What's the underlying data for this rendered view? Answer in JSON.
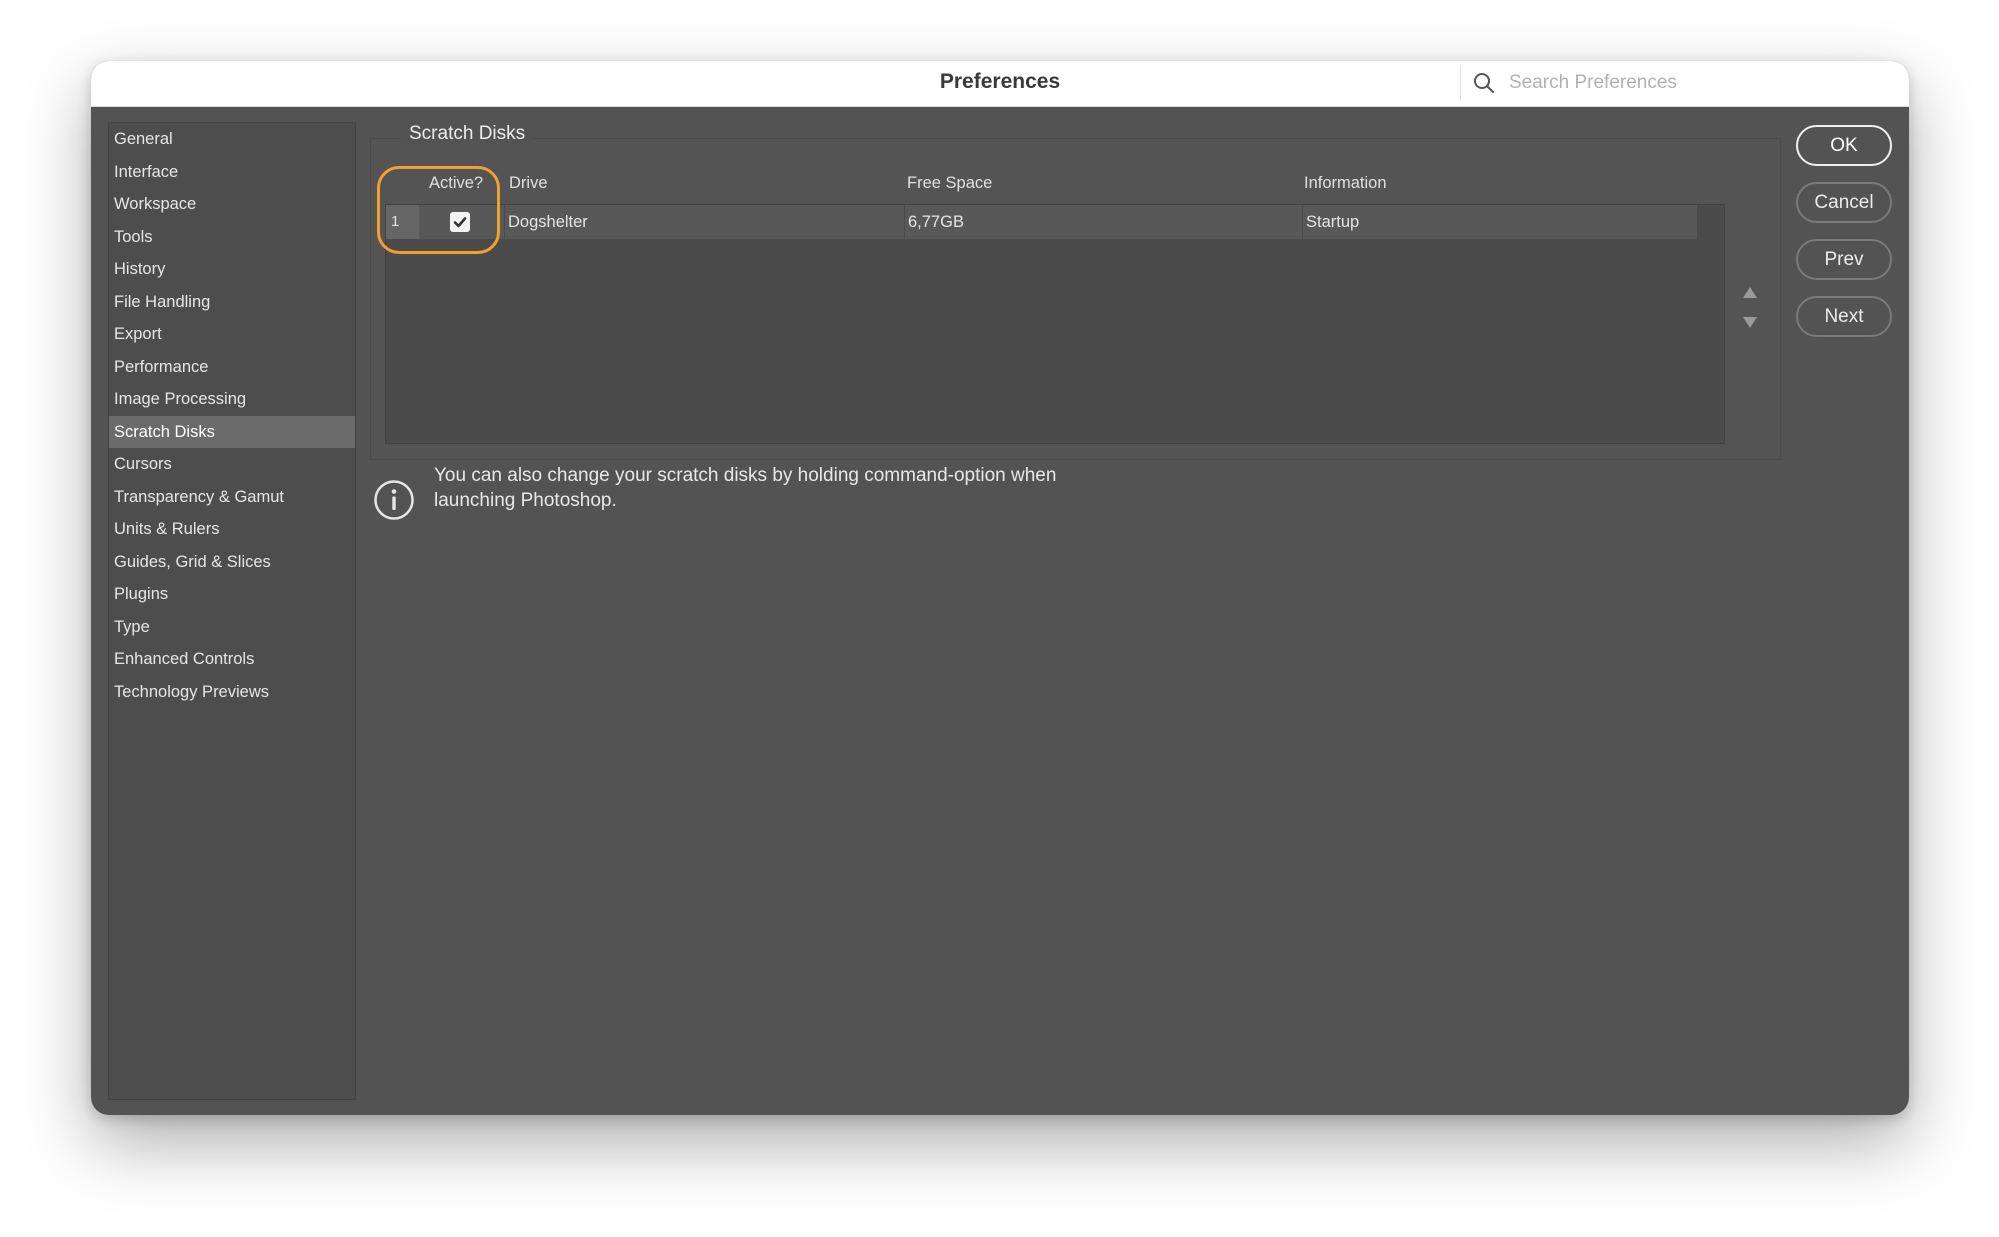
{
  "window": {
    "title": "Preferences",
    "search_placeholder": "Search Preferences"
  },
  "sidebar": {
    "selected": "Scratch Disks",
    "items": [
      {
        "label": "General"
      },
      {
        "label": "Interface"
      },
      {
        "label": "Workspace"
      },
      {
        "label": "Tools"
      },
      {
        "label": "History"
      },
      {
        "label": "File Handling"
      },
      {
        "label": "Export"
      },
      {
        "label": "Performance"
      },
      {
        "label": "Image Processing"
      },
      {
        "label": "Scratch Disks"
      },
      {
        "label": "Cursors"
      },
      {
        "label": "Transparency & Gamut"
      },
      {
        "label": "Units & Rulers"
      },
      {
        "label": "Guides, Grid & Slices"
      },
      {
        "label": "Plugins"
      },
      {
        "label": "Type"
      },
      {
        "label": "Enhanced Controls"
      },
      {
        "label": "Technology Previews"
      }
    ]
  },
  "scratch_disks": {
    "title": "Scratch Disks",
    "columns": {
      "active": "Active?",
      "drive": "Drive",
      "free_space": "Free Space",
      "information": "Information"
    },
    "rows": [
      {
        "index": "1",
        "active": true,
        "drive": "Dogshelter",
        "free_space": "6,77GB",
        "information": "Startup"
      }
    ]
  },
  "info": {
    "line1": "You can also change your scratch disks by holding command-option when",
    "line2": "launching Photoshop."
  },
  "buttons": {
    "ok": "OK",
    "cancel": "Cancel",
    "prev": "Prev",
    "next": "Next"
  },
  "colors": {
    "highlight": "#f0a030",
    "panel_bg": "#535353",
    "selected_item": "#6b6b6b"
  }
}
